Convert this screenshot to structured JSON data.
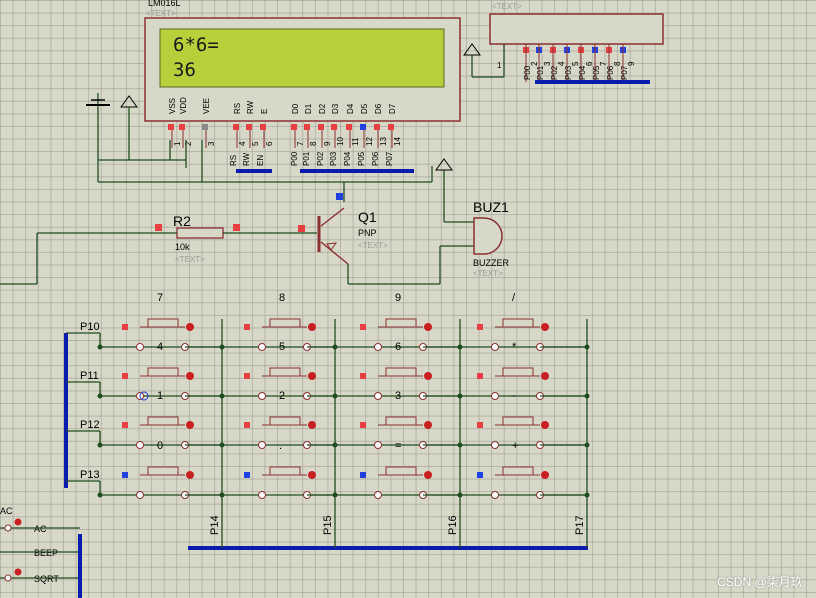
{
  "lcd": {
    "name": "LM016L",
    "text_tag": "<TEXT>",
    "line1": "6*6=",
    "line2": "36",
    "header_pins": [
      "VSS",
      "VDD",
      "VEE",
      "RS",
      "RW",
      "E",
      "D0",
      "D1",
      "D2",
      "D3",
      "D4",
      "D5",
      "D6",
      "D7"
    ],
    "pin_numbers": [
      "1",
      "2",
      "3",
      "4",
      "5",
      "6",
      "7",
      "8",
      "9",
      "10",
      "11",
      "12",
      "13",
      "14"
    ],
    "bottom_labels": [
      "RS",
      "RW",
      "EN",
      "P00",
      "P01",
      "P02",
      "P03",
      "P04",
      "P05",
      "P06",
      "P07"
    ]
  },
  "resistor_pack": {
    "text_tag": "<TEXT>",
    "pin1": "1",
    "labels": [
      "P00",
      "P01",
      "P02",
      "P03",
      "P04",
      "P05",
      "P06",
      "P07"
    ],
    "pin_numbers": [
      "2",
      "3",
      "4",
      "5",
      "6",
      "7",
      "8",
      "9"
    ]
  },
  "r2": {
    "name": "R2",
    "value": "10k",
    "text_tag": "<TEXT>"
  },
  "q1": {
    "name": "Q1",
    "type": "PNP",
    "text_tag": "<TEXT>"
  },
  "buz1": {
    "name": "BUZ1",
    "type": "BUZZER",
    "text_tag": "<TEXT>"
  },
  "keypad": {
    "rows": [
      "P10",
      "P11",
      "P12",
      "P13"
    ],
    "cols": [
      "P14",
      "P15",
      "P16",
      "P17"
    ],
    "keys": [
      [
        "7",
        "8",
        "9",
        "/"
      ],
      [
        "4",
        "5",
        "6",
        "*"
      ],
      [
        "1",
        "2",
        "3",
        "-"
      ],
      [
        "0",
        ".",
        "=",
        "+"
      ]
    ]
  },
  "side_buttons": [
    "AC",
    "BEEP",
    "SQRT"
  ],
  "side_top_label": "AC",
  "watermark": "CSDN @柒月玖."
}
